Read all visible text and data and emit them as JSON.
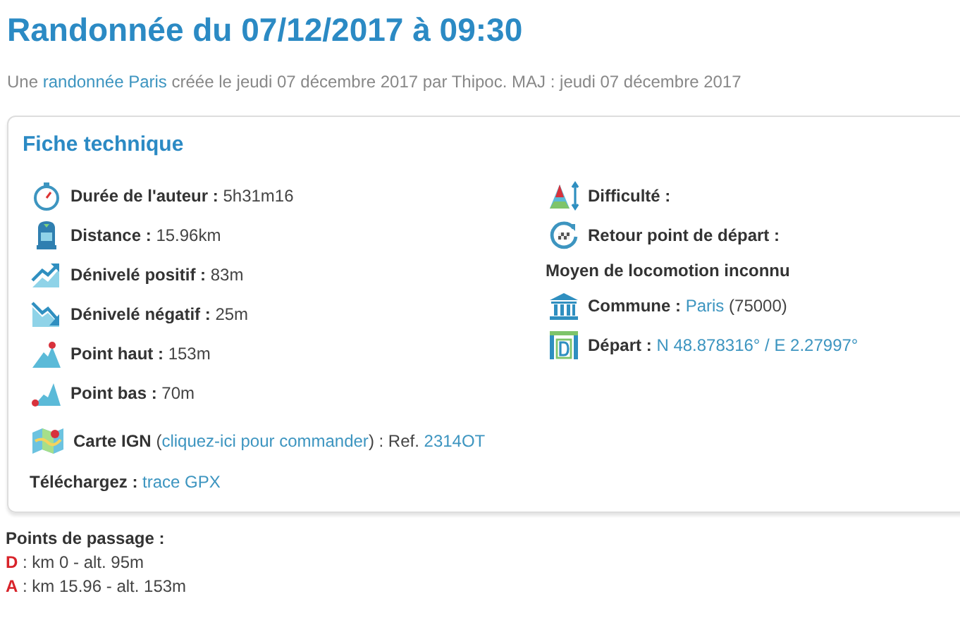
{
  "title": "Randonnée du 07/12/2017 à 09:30",
  "subtitle": [
    {
      "kind": "text",
      "text": "Une "
    },
    {
      "kind": "link",
      "text": "randonnée Paris"
    },
    {
      "kind": "text",
      "text": " créée le jeudi 07 décembre 2017 par Thipoc. MAJ : jeudi 07 décembre 2017"
    }
  ],
  "card": {
    "heading": "Fiche technique",
    "left_rows": [
      {
        "parts": [
          {
            "kind": "label",
            "text": "Durée de l'auteur :"
          },
          {
            "kind": "text",
            "text": " 5h31m16"
          }
        ]
      },
      {
        "parts": [
          {
            "kind": "label",
            "text": "Distance :"
          },
          {
            "kind": "text",
            "text": " 15.96km"
          }
        ]
      },
      {
        "parts": [
          {
            "kind": "label",
            "text": "Dénivelé positif :"
          },
          {
            "kind": "text",
            "text": " 83m"
          }
        ]
      },
      {
        "parts": [
          {
            "kind": "label",
            "text": "Dénivelé négatif :"
          },
          {
            "kind": "text",
            "text": " 25m"
          }
        ]
      },
      {
        "parts": [
          {
            "kind": "label",
            "text": "Point haut :"
          },
          {
            "kind": "text",
            "text": " 153m"
          }
        ]
      },
      {
        "parts": [
          {
            "kind": "label",
            "text": "Point bas :"
          },
          {
            "kind": "text",
            "text": " 70m"
          }
        ]
      }
    ],
    "right_rows": [
      {
        "parts": [
          {
            "kind": "label",
            "text": "Difficulté :"
          }
        ]
      },
      {
        "parts": [
          {
            "kind": "label",
            "text": "Retour point de départ :"
          }
        ]
      },
      {
        "parts": [
          {
            "kind": "label",
            "text": "Moyen de locomotion inconnu"
          }
        ]
      },
      {
        "parts": [
          {
            "kind": "label",
            "text": "Commune :"
          },
          {
            "kind": "link",
            "text": "Paris"
          },
          {
            "kind": "text",
            "text": " (75000)"
          }
        ]
      },
      {
        "parts": [
          {
            "kind": "label",
            "text": "Départ :"
          },
          {
            "kind": "link",
            "text": "N 48.878316° / E 2.27997°"
          }
        ]
      }
    ],
    "map_row": {
      "parts": [
        {
          "kind": "label",
          "text": "Carte IGN"
        },
        {
          "kind": "text",
          "text": " ("
        },
        {
          "kind": "link",
          "text": "cliquez-ici pour commander"
        },
        {
          "kind": "text",
          "text": ") : Ref. "
        },
        {
          "kind": "link",
          "text": "2314OT"
        }
      ]
    },
    "download_row": {
      "parts": [
        {
          "kind": "label",
          "text": "Téléchargez :"
        },
        {
          "kind": "link",
          "text": "trace GPX"
        }
      ]
    }
  },
  "waypoints": {
    "heading": "Points de passage :",
    "items": [
      {
        "marker": "D",
        "text": " : km 0 - alt. 95m"
      },
      {
        "marker": "A",
        "text": " : km 15.96 - alt. 153m"
      }
    ]
  }
}
